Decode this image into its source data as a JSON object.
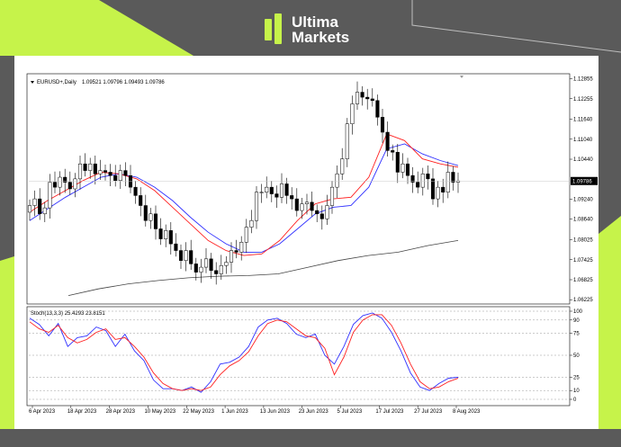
{
  "brand": {
    "name_line1": "Ultima",
    "name_line2": "Markets",
    "accent_color": "#c6f34a"
  },
  "chart_data": [
    {
      "type": "candlestick",
      "title": "EURUSD+,Daily",
      "ohlc_text": "1.09521 1.09796 1.09493 1.09786",
      "current_price": "1.09786",
      "y_ticks": [
        "1.12855",
        "1.12255",
        "1.11640",
        "1.11040",
        "1.10440",
        "1.09240",
        "1.08640",
        "1.08025",
        "1.07425",
        "1.06825",
        "1.06225"
      ],
      "ylim": [
        1.0615,
        1.1295
      ],
      "x_ticks": [
        "6 Apr 2023",
        "18 Apr 2023",
        "28 Apr 2023",
        "10 May 2023",
        "22 May 2023",
        "1 Jun 2023",
        "13 Jun 2023",
        "23 Jun 2023",
        "5 Jul 2023",
        "17 Jul 2023",
        "27 Jul 2023",
        "8 Aug 2023"
      ],
      "grid": false,
      "series": [
        {
          "kind": "price_close",
          "color": "#000000",
          "values": [
            1.0905,
            1.0925,
            1.088,
            1.0898,
            1.0975,
            1.096,
            1.099,
            1.0975,
            1.0955,
            1.0985,
            1.103,
            1.101,
            1.103,
            1.1,
            1.101,
            1.1005,
            1.0995,
            1.098,
            1.101,
            1.0995,
            1.096,
            1.0935,
            1.0905,
            1.086,
            1.088,
            1.0835,
            1.0805,
            1.083,
            1.079,
            1.077,
            1.074,
            1.077,
            1.073,
            1.0705,
            1.072,
            1.0745,
            1.071,
            1.07,
            1.0725,
            1.0735,
            1.077,
            1.0765,
            1.0795,
            1.084,
            1.086,
            1.0945,
            1.0945,
            1.096,
            1.094,
            1.093,
            1.097,
            1.0935,
            1.0925,
            1.089,
            1.091,
            1.0915,
            1.089,
            1.088,
            1.0865,
            1.0905,
            1.096,
            1.1,
            1.1045,
            1.115,
            1.121,
            1.1245,
            1.123,
            1.1225,
            1.122,
            1.117,
            1.1125,
            1.107,
            1.1065,
            1.1005,
            1.103,
            1.0995,
            1.0975,
            1.096,
            1.1,
            1.0985,
            1.0925,
            1.096,
            1.0945,
            1.1005,
            1.0975,
            1.0979
          ]
        },
        {
          "kind": "ma_fast",
          "color": "#ff2020",
          "values": [
            1.0885,
            1.092,
            1.095,
            1.098,
            1.1005,
            1.1,
            1.0985,
            1.095,
            1.09,
            1.085,
            1.08,
            1.077,
            1.0755,
            1.076,
            1.08,
            1.086,
            1.091,
            1.0925,
            1.093,
            1.099,
            1.112,
            1.11,
            1.1045,
            1.103,
            1.102
          ]
        },
        {
          "kind": "ma_mid",
          "color": "#3030ff",
          "values": [
            1.086,
            1.0895,
            1.093,
            1.096,
            1.099,
            1.1,
            1.099,
            1.096,
            1.092,
            1.087,
            1.0825,
            1.079,
            1.0765,
            1.0765,
            1.079,
            1.0835,
            1.088,
            1.09,
            1.0905,
            1.096,
            1.1075,
            1.109,
            1.106,
            1.104,
            1.1025
          ]
        },
        {
          "kind": "ma_slow",
          "color": "#444444",
          "values": [
            1.0635,
            1.0655,
            1.067,
            1.068,
            1.0688,
            1.0693,
            1.0695,
            1.07,
            1.072,
            1.074,
            1.0755,
            1.0765,
            1.0785,
            1.08
          ]
        }
      ]
    },
    {
      "type": "line",
      "title": "Stoch(13,3,3) 25.4293 23.8151",
      "ylim": [
        0,
        100
      ],
      "y_ticks": [
        "100",
        "90",
        "75",
        "50",
        "25",
        "10",
        "0"
      ],
      "series": [
        {
          "kind": "main",
          "color": "#3030ff",
          "values": [
            92,
            85,
            72,
            86,
            60,
            70,
            72,
            82,
            78,
            60,
            74,
            55,
            44,
            22,
            12,
            12,
            10,
            14,
            8,
            20,
            40,
            42,
            48,
            60,
            82,
            90,
            92,
            86,
            74,
            70,
            74,
            50,
            40,
            60,
            85,
            95,
            98,
            92,
            76,
            55,
            30,
            14,
            10,
            18,
            24,
            25
          ]
        },
        {
          "kind": "signal",
          "color": "#ff2020",
          "values": [
            88,
            80,
            76,
            84,
            70,
            64,
            68,
            76,
            80,
            68,
            70,
            60,
            48,
            30,
            18,
            12,
            10,
            12,
            10,
            14,
            28,
            38,
            44,
            54,
            72,
            86,
            90,
            88,
            80,
            72,
            70,
            58,
            28,
            48,
            76,
            90,
            96,
            96,
            84,
            64,
            40,
            20,
            12,
            14,
            20,
            24
          ]
        }
      ]
    }
  ]
}
